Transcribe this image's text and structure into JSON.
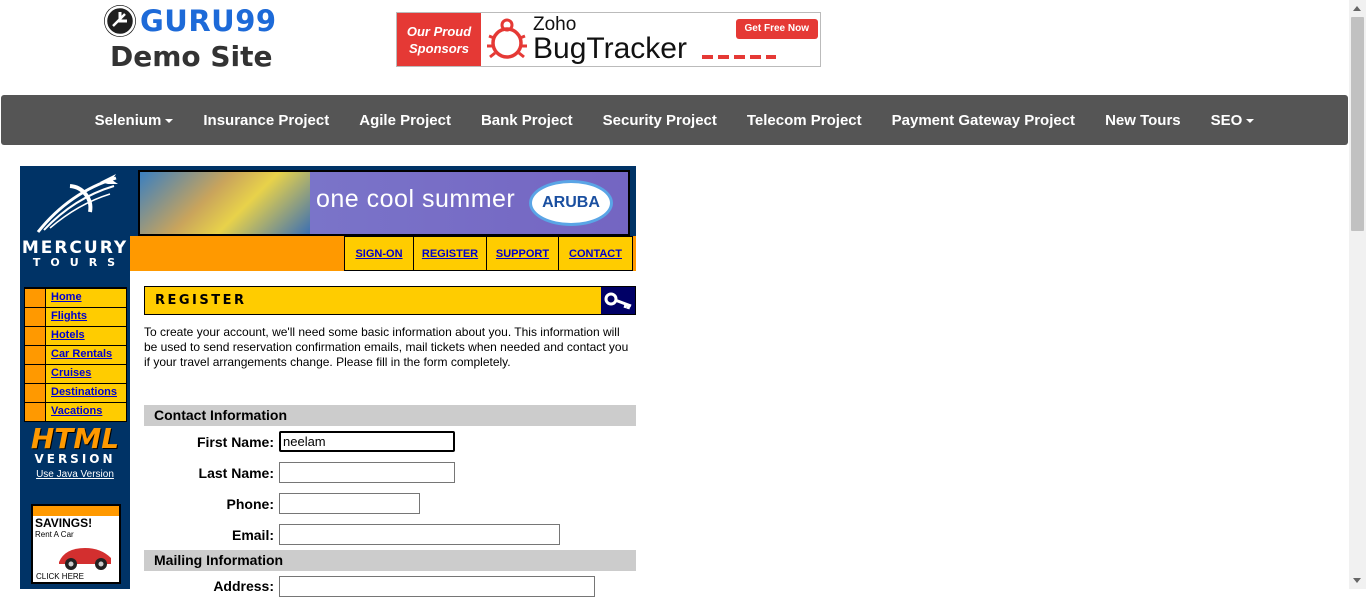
{
  "header": {
    "logo_name": "GURU99",
    "logo_sub": "Demo Site",
    "ad": {
      "left_line1": "Our Proud",
      "left_line2": "Sponsors",
      "brand_top": "Zoho",
      "brand_main": "BugTracker",
      "cta": "Get Free Now"
    }
  },
  "nav": {
    "items": [
      {
        "label": "Selenium",
        "dropdown": true
      },
      {
        "label": "Insurance Project"
      },
      {
        "label": "Agile Project"
      },
      {
        "label": "Bank Project"
      },
      {
        "label": "Security Project"
      },
      {
        "label": "Telecom Project"
      },
      {
        "label": "Payment Gateway Project"
      },
      {
        "label": "New Tours"
      },
      {
        "label": "SEO",
        "dropdown": true
      }
    ]
  },
  "mercury": {
    "logo_line1": "MERCURY",
    "logo_line2": "TOURS",
    "banner_text": "one cool summer",
    "banner_badge": "ARUBA",
    "top_links": [
      "SIGN-ON",
      "REGISTER",
      "SUPPORT",
      "CONTACT"
    ],
    "side_menu": [
      "Home",
      "Flights",
      "Hotels",
      "Car Rentals",
      "Cruises",
      "Destinations",
      "Vacations"
    ],
    "html_version_big": "HTML",
    "html_version_small": "VERSION",
    "java_link": "Use Java Version",
    "savings_title": "SAVINGS!",
    "savings_sub": "Rent A Car",
    "savings_click": "CLICK HERE"
  },
  "register": {
    "title": "REGISTER",
    "intro": "To create your account, we'll need some basic information about you. This information will be used to send reservation confirmation emails, mail tickets when needed and contact you if your travel arrangements change. Please fill in the form completely.",
    "contact_section": "Contact Information",
    "first_name_label": "First Name:",
    "first_name_value": "neelam",
    "last_name_label": "Last Name:",
    "last_name_value": "",
    "phone_label": "Phone:",
    "phone_value": "",
    "email_label": "Email:",
    "email_value": "",
    "mailing_section": "Mailing Information",
    "address_label": "Address:",
    "address_value": ""
  },
  "colors": {
    "nav_bg": "#555555",
    "guru_blue": "#1d6ad8",
    "mercury_navy": "#003366",
    "mercury_orange": "#ff9900",
    "mercury_yellow": "#ffcc00",
    "ad_red": "#e53935"
  }
}
